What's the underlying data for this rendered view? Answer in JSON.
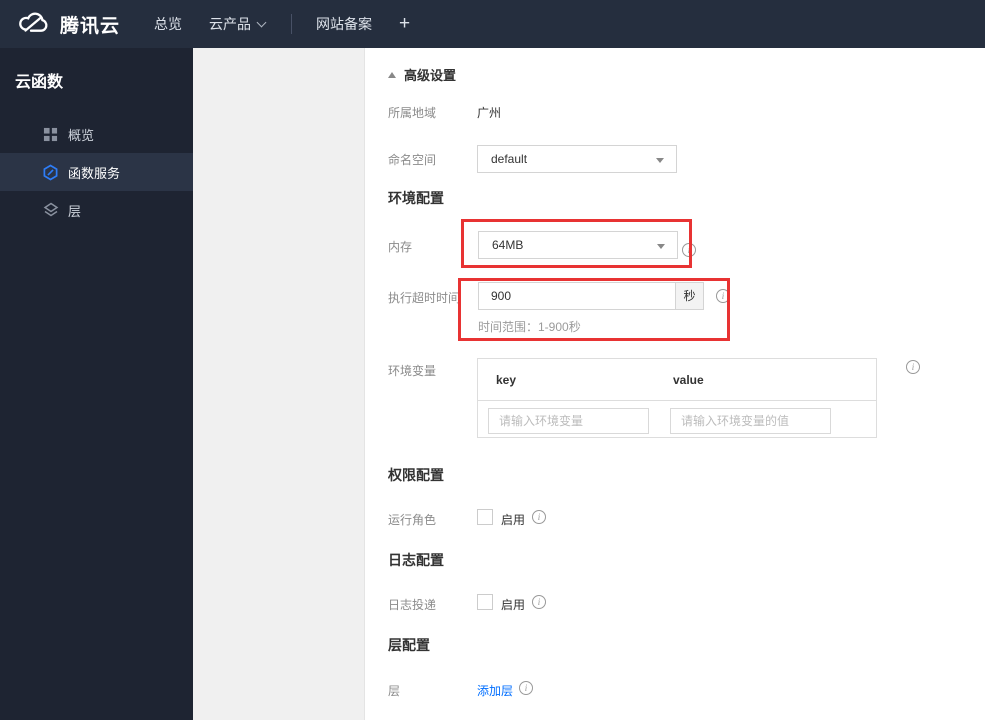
{
  "topbar": {
    "brand": "腾讯云",
    "nav_overview": "总览",
    "nav_products": "云产品",
    "nav_beian": "网站备案",
    "nav_add": "+"
  },
  "sidebar": {
    "title": "云函数",
    "items": [
      {
        "label": "概览",
        "icon": "overview-grid-icon",
        "active": false
      },
      {
        "label": "函数服务",
        "icon": "function-hexagon-icon",
        "active": true
      },
      {
        "label": "层",
        "icon": "layers-icon",
        "active": false
      }
    ]
  },
  "content": {
    "advanced_settings": "高级设置",
    "region_label": "所属地域",
    "region_value": "广州",
    "namespace_label": "命名空间",
    "namespace_value": "default",
    "section_env": "环境配置",
    "memory_label": "内存",
    "memory_value": "64MB",
    "timeout_label": "执行超时时间",
    "timeout_value": "900",
    "timeout_unit": "秒",
    "timeout_hint": "时间范围：1-900秒",
    "envvar_label": "环境变量",
    "envvar_key_header": "key",
    "envvar_value_header": "value",
    "envvar_key_placeholder": "请输入环境变量",
    "envvar_value_placeholder": "请输入环境变量的值",
    "section_perm": "权限配置",
    "role_label": "运行角色",
    "role_enable": "启用",
    "section_log": "日志配置",
    "log_label": "日志投递",
    "log_enable": "启用",
    "section_layer": "层配置",
    "layer_label": "层",
    "layer_add_link": "添加层"
  },
  "colors": {
    "topbar_bg": "#252e3e",
    "sidebar_bg": "#1e2432",
    "sidebar_active_bg": "#2b3446",
    "highlight_red": "#e83333",
    "link_blue": "#006eff",
    "function_icon_blue": "#2e7df7"
  }
}
